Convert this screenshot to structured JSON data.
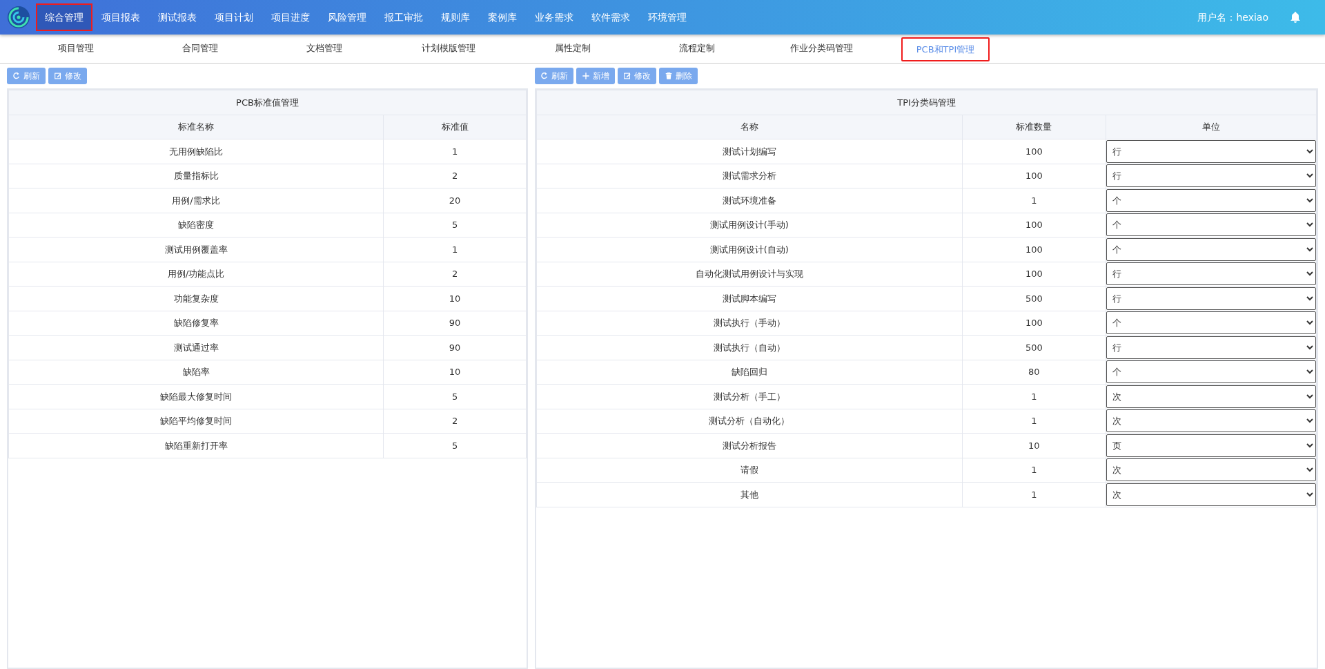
{
  "nav": {
    "items": [
      {
        "label": "综合管理",
        "selected": true,
        "highlighted": true
      },
      {
        "label": "项目报表",
        "selected": false,
        "highlighted": false
      },
      {
        "label": "测试报表",
        "selected": false,
        "highlighted": false
      },
      {
        "label": "项目计划",
        "selected": false,
        "highlighted": false
      },
      {
        "label": "项目进度",
        "selected": false,
        "highlighted": false
      },
      {
        "label": "风险管理",
        "selected": false,
        "highlighted": false
      },
      {
        "label": "报工审批",
        "selected": false,
        "highlighted": false
      },
      {
        "label": "规则库",
        "selected": false,
        "highlighted": false
      },
      {
        "label": "案例库",
        "selected": false,
        "highlighted": false
      },
      {
        "label": "业务需求",
        "selected": false,
        "highlighted": false
      },
      {
        "label": "软件需求",
        "selected": false,
        "highlighted": false
      },
      {
        "label": "环境管理",
        "selected": false,
        "highlighted": false
      }
    ],
    "user": "用户名：hexiao"
  },
  "tabs": [
    {
      "label": "项目管理",
      "selected": false,
      "highlighted": false
    },
    {
      "label": "合同管理",
      "selected": false,
      "highlighted": false
    },
    {
      "label": "文档管理",
      "selected": false,
      "highlighted": false
    },
    {
      "label": "计划模版管理",
      "selected": false,
      "highlighted": false
    },
    {
      "label": "属性定制",
      "selected": false,
      "highlighted": false
    },
    {
      "label": "流程定制",
      "selected": false,
      "highlighted": false
    },
    {
      "label": "作业分类码管理",
      "selected": false,
      "highlighted": false
    },
    {
      "label": "PCB和TPI管理",
      "selected": true,
      "highlighted": true
    }
  ],
  "pcb": {
    "toolbar": [
      {
        "kind": "refresh",
        "label": "刷新"
      },
      {
        "kind": "edit",
        "label": "修改"
      }
    ],
    "title": "PCB标准值管理",
    "columns": [
      "标准名称",
      "标准值"
    ],
    "rows": [
      [
        "无用例缺陷比",
        "1"
      ],
      [
        "质量指标比",
        "2"
      ],
      [
        "用例/需求比",
        "20"
      ],
      [
        "缺陷密度",
        "5"
      ],
      [
        "测试用例覆盖率",
        "1"
      ],
      [
        "用例/功能点比",
        "2"
      ],
      [
        "功能复杂度",
        "10"
      ],
      [
        "缺陷修复率",
        "90"
      ],
      [
        "测试通过率",
        "90"
      ],
      [
        "缺陷率",
        "10"
      ],
      [
        "缺陷最大修复时间",
        "5"
      ],
      [
        "缺陷平均修复时间",
        "2"
      ],
      [
        "缺陷重新打开率",
        "5"
      ]
    ]
  },
  "tpi": {
    "toolbar": [
      {
        "kind": "refresh",
        "label": "刷新"
      },
      {
        "kind": "add",
        "label": "新增"
      },
      {
        "kind": "edit",
        "label": "修改"
      },
      {
        "kind": "delete",
        "label": "删除"
      }
    ],
    "title": "TPI分类码管理",
    "columns": [
      "名称",
      "标准数量",
      "单位"
    ],
    "rows": [
      [
        "测试计划编写",
        "100",
        "行"
      ],
      [
        "测试需求分析",
        "100",
        "行"
      ],
      [
        "测试环境准备",
        "1",
        "个"
      ],
      [
        "测试用例设计(手动)",
        "100",
        "个"
      ],
      [
        "测试用例设计(自动)",
        "100",
        "个"
      ],
      [
        "自动化测试用例设计与实现",
        "100",
        "行"
      ],
      [
        "测试脚本编写",
        "500",
        "行"
      ],
      [
        "测试执行（手动）",
        "100",
        "个"
      ],
      [
        "测试执行（自动）",
        "500",
        "行"
      ],
      [
        "缺陷回归",
        "80",
        "个"
      ],
      [
        "测试分析（手工）",
        "1",
        "次"
      ],
      [
        "测试分析（自动化）",
        "1",
        "次"
      ],
      [
        "测试分析报告",
        "10",
        "页"
      ],
      [
        "请假",
        "1",
        "次"
      ],
      [
        "其他",
        "1",
        "次"
      ]
    ]
  }
}
